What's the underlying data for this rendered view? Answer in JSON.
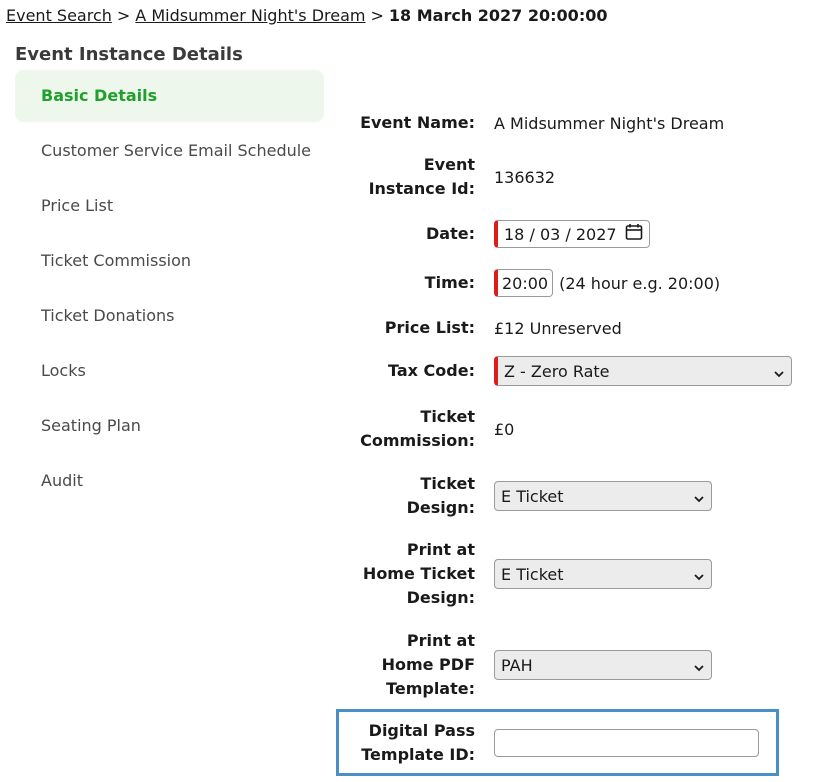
{
  "breadcrumb": {
    "link1": "Event Search",
    "link2": "A Midsummer Night's Dream",
    "separator": ">",
    "current": "18 March 2027 20:00:00"
  },
  "section_title": "Event Instance Details",
  "sidebar": {
    "items": [
      {
        "label": "Basic Details",
        "active": true
      },
      {
        "label": "Customer Service Email Schedule"
      },
      {
        "label": "Price List"
      },
      {
        "label": "Ticket Commission"
      },
      {
        "label": "Ticket Donations"
      },
      {
        "label": "Locks"
      },
      {
        "label": "Seating Plan"
      },
      {
        "label": "Audit"
      }
    ]
  },
  "form": {
    "event_name": {
      "label_1": "Event Name:",
      "value": "A Midsummer Night's Dream"
    },
    "instance_id": {
      "label_1": "Event",
      "label_2": "Instance Id:",
      "value": "136632"
    },
    "date": {
      "label_1": "Date:",
      "day": "18",
      "month": "03",
      "year": "2027",
      "sep": "/"
    },
    "time": {
      "label_1": "Time:",
      "value": "20:00",
      "hint": "(24 hour e.g. 20:00)"
    },
    "price_list": {
      "label_1": "Price List:",
      "value": "£12 Unreserved"
    },
    "tax_code": {
      "label_1": "Tax Code:",
      "value": "Z - Zero Rate"
    },
    "ticket_commission": {
      "label_1": "Ticket",
      "label_2": "Commission:",
      "value": "£0"
    },
    "ticket_design": {
      "label_1": "Ticket",
      "label_2": "Design:",
      "value": "E Ticket"
    },
    "pah_ticket_design": {
      "label_1": "Print at",
      "label_2": "Home Ticket",
      "label_3": "Design:",
      "value": "E Ticket"
    },
    "pah_pdf_template": {
      "label_1": "Print at",
      "label_2": "Home PDF",
      "label_3": "Template:",
      "value": "PAH"
    },
    "digital_pass": {
      "label_1": "Digital Pass",
      "label_2": "Template ID:",
      "value": ""
    }
  },
  "colors": {
    "accent_green": "#1fa02c",
    "required_red": "#e01b1b",
    "highlight_blue": "#4a90c4"
  }
}
